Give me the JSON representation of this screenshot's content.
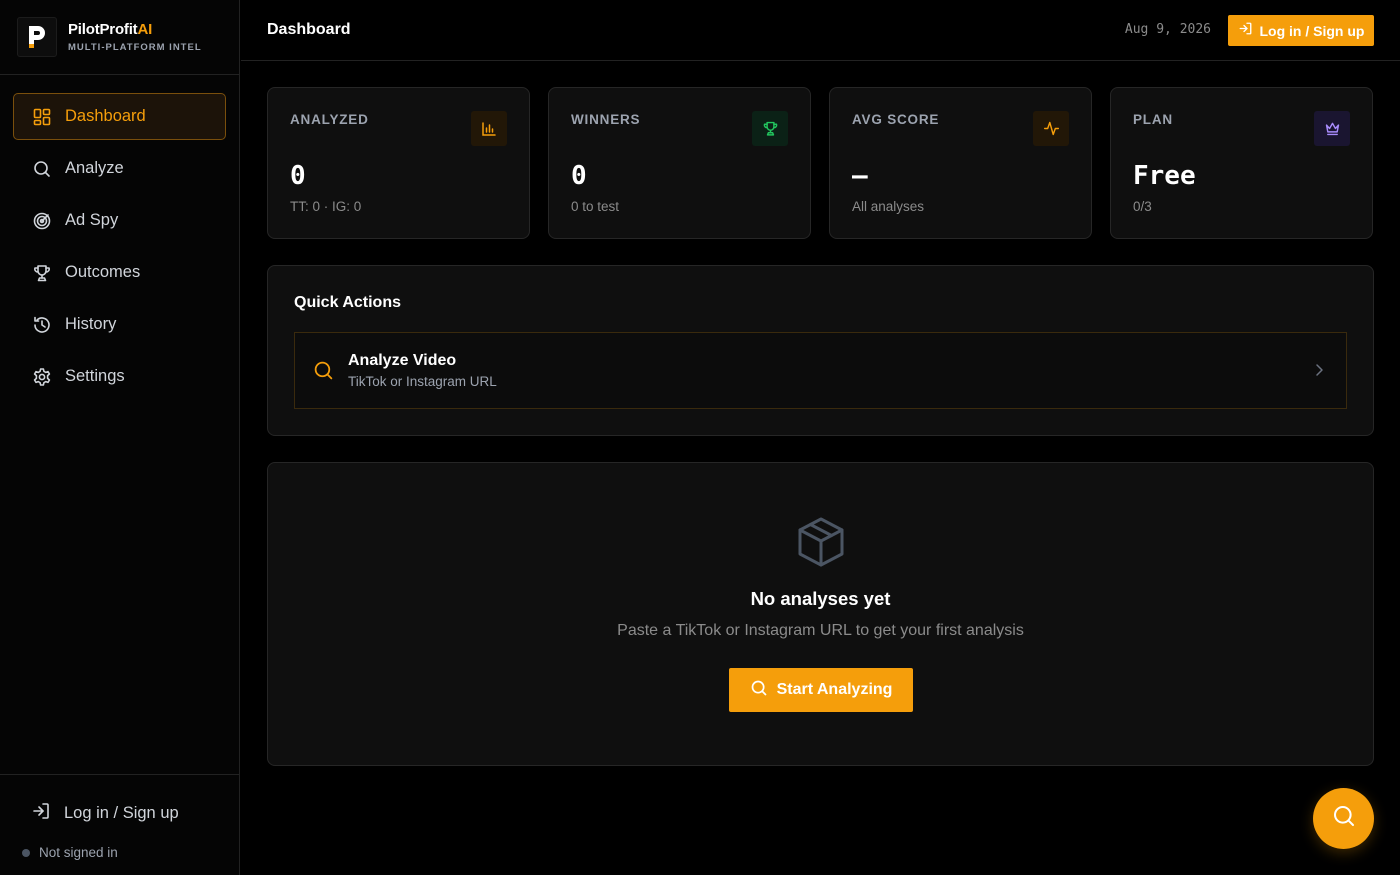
{
  "brand": {
    "name": "PilotProfit",
    "name_accent": "AI",
    "subtitle": "MULTI-PLATFORM INTEL"
  },
  "sidebar": {
    "items": [
      {
        "label": "Dashboard",
        "icon": "dashboard-icon",
        "active": true
      },
      {
        "label": "Analyze",
        "icon": "search-icon"
      },
      {
        "label": "Ad Spy",
        "icon": "radar-icon"
      },
      {
        "label": "Outcomes",
        "icon": "trophy-icon"
      },
      {
        "label": "History",
        "icon": "history-icon"
      },
      {
        "label": "Settings",
        "icon": "gear-icon"
      }
    ],
    "footer": {
      "login_label": "Log in / Sign up",
      "status_text": "Not signed in"
    }
  },
  "header": {
    "title": "Dashboard",
    "date": "Aug 9, 2026",
    "login_button": "Log in / Sign up"
  },
  "stats": [
    {
      "label": "ANALYZED",
      "value": "0",
      "sub": "TT: 0 · IG: 0",
      "icon": "bar-chart-icon",
      "color": "#f59e0b"
    },
    {
      "label": "WINNERS",
      "value": "0",
      "sub": "0 to test",
      "icon": "trophy-icon",
      "color": "#22c55e"
    },
    {
      "label": "AVG SCORE",
      "value": "—",
      "sub": "All analyses",
      "icon": "activity-icon",
      "color": "#f59e0b"
    },
    {
      "label": "PLAN",
      "value": "Free",
      "sub": "0/3",
      "icon": "crown-icon",
      "color": "#a78bfa"
    }
  ],
  "quick_actions": {
    "title": "Quick Actions",
    "items": [
      {
        "title": "Analyze Video",
        "subtitle": "TikTok or Instagram URL",
        "icon": "search-icon"
      }
    ]
  },
  "empty_state": {
    "icon": "box-icon",
    "title": "No analyses yet",
    "text": "Paste a TikTok or Instagram URL to get your first analysis",
    "button": "Start Analyzing"
  },
  "colors": {
    "accent": "#f59e0b",
    "background": "#000000",
    "card": "#0f0f0f",
    "border": "#262626"
  }
}
